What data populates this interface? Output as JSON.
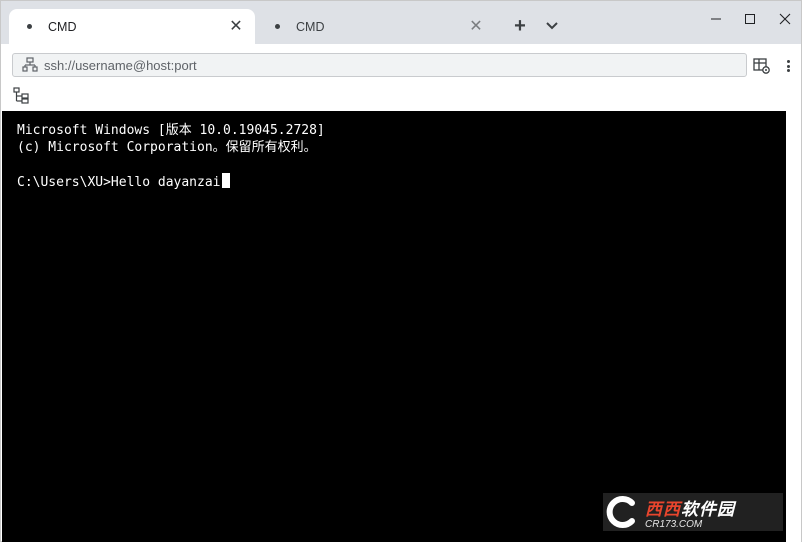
{
  "tabs": [
    {
      "label": "CMD",
      "active": true
    },
    {
      "label": "CMD",
      "active": false
    }
  ],
  "address": {
    "placeholder": "ssh://username@host:port"
  },
  "terminal": {
    "lines": [
      "Microsoft Windows [版本 10.0.19045.2728]",
      "(c) Microsoft Corporation。保留所有权利。",
      "",
      "C:\\Users\\XU>Hello dayanzai"
    ]
  },
  "watermark": {
    "brand": "西西",
    "suffix": "软件园",
    "url": "CR173.COM"
  },
  "icons": {
    "tab_dot": "circle-dot-icon",
    "tab_close": "close-icon",
    "new_tab": "plus-icon",
    "tab_menu": "chevron-down-icon",
    "network": "network-icon",
    "settings": "settings-icon",
    "more": "more-vertical-icon",
    "sitemap": "sitemap-icon"
  }
}
